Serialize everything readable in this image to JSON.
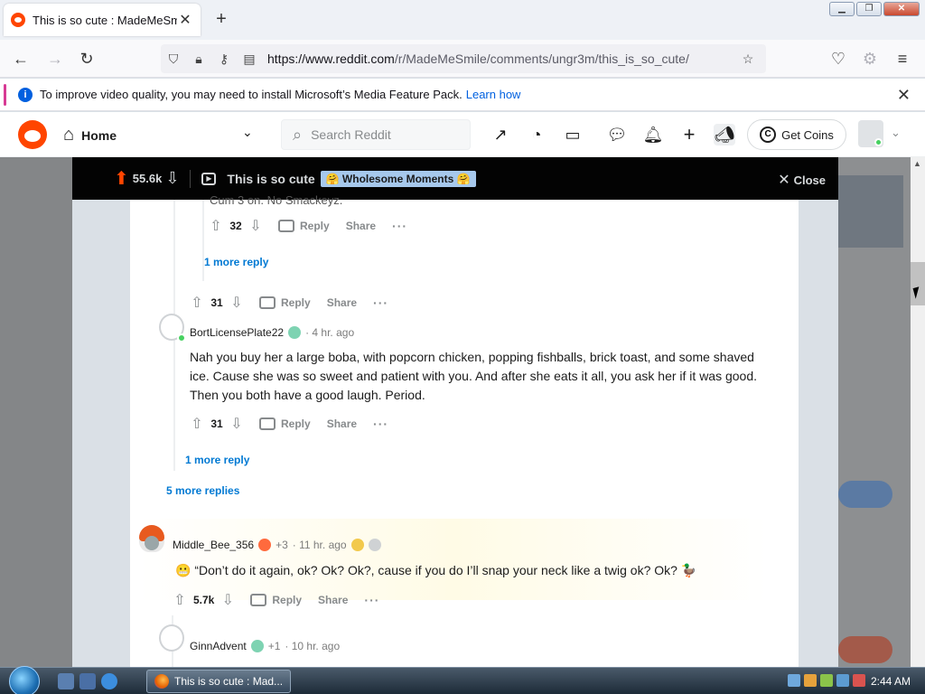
{
  "browser": {
    "tab_title": "This is so cute : MadeMeSmile",
    "tab_close": "✕",
    "new_tab": "+",
    "url_base": "https://www.reddit.com",
    "url_path": "/r/MadeMeSmile/comments/ungr3m/this_is_so_cute/",
    "infobar_message": "To improve video quality, you may need to install Microsoft’s Media Feature Pack.",
    "infobar_link": "Learn how",
    "infobar_close": "✕"
  },
  "reddit_header": {
    "home_label": "Home",
    "search_placeholder": "Search Reddit",
    "coins_label": "Get Coins",
    "coins_icon": "C"
  },
  "post_bar": {
    "score": "55.6k",
    "title": "This is so cute",
    "flair": "🤗 Wholesome Moments 🤗",
    "close_label": "Close"
  },
  "comments": {
    "c0": {
      "partial_text": "Cum 3 on. No Smackeyz.",
      "votes": "32",
      "reply": "Reply",
      "share": "Share",
      "more_reply": "1 more reply"
    },
    "c1": {
      "votes": "31",
      "reply": "Reply",
      "share": "Share"
    },
    "c2": {
      "username": "BortLicensePlate22",
      "time": "· 4 hr. ago",
      "text": "Nah you buy her a large boba, with popcorn chicken, popping fishballs, brick toast, and some shaved ice. Cause she was so sweet and patient with you. And after she eats it all, you ask her if it was good. Then you both have a good laugh. Period.",
      "votes": "31",
      "reply": "Reply",
      "share": "Share",
      "more_reply": "1 more reply"
    },
    "more_replies": "5 more replies",
    "c3": {
      "username": "Middle_Bee_356",
      "plus": "+3",
      "time": "· 11 hr. ago",
      "text": "“Don’t do it again, ok? Ok? Ok?, cause if you do I’ll snap your neck like a twig ok? Ok?",
      "votes": "5.7k",
      "reply": "Reply",
      "share": "Share"
    },
    "c4": {
      "username": "GinnAdvent",
      "plus": "+1",
      "time": "· 10 hr. ago"
    }
  },
  "taskbar": {
    "task_label": "This is so cute : Mad...",
    "clock": "2:44 AM"
  },
  "colors": {
    "reddit_orange": "#ff4500",
    "link_blue": "#0079d3",
    "online_green": "#46d160"
  }
}
